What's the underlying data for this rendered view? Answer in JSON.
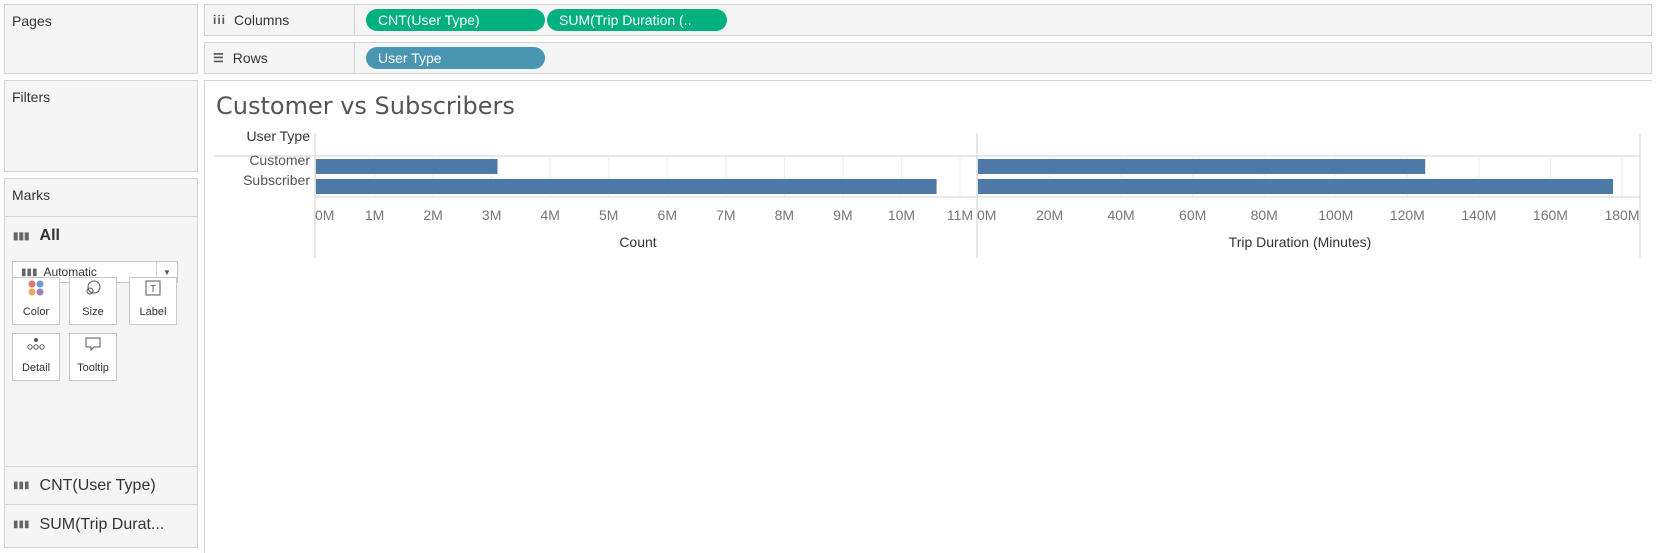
{
  "left_panel": {
    "pages_title": "Pages",
    "filters_title": "Filters",
    "marks_title": "Marks",
    "marks_all_label": "All",
    "mark_type": "Automatic",
    "cards": [
      {
        "icon": "color-icon",
        "label": "Color"
      },
      {
        "icon": "size-icon",
        "label": "Size"
      },
      {
        "icon": "label-icon",
        "label": "Label"
      },
      {
        "icon": "detail-icon",
        "label": "Detail"
      },
      {
        "icon": "tooltip-icon",
        "label": "Tooltip"
      }
    ],
    "measure_items": [
      "CNT(User Type)",
      "SUM(Trip Durat..."
    ]
  },
  "shelves": {
    "columns_label": "Columns",
    "columns_pills": [
      "CNT(User Type)",
      "SUM(Trip Duration (.."
    ],
    "rows_label": "Rows",
    "rows_pills": [
      "User Type"
    ]
  },
  "colors": {
    "measure_pill": "#00b180",
    "dimension_pill": "#4996b2",
    "bar": "#4e79a7"
  },
  "chart_title": "Customer vs Subscribers",
  "chart_data": {
    "type": "bar",
    "orientation": "horizontal",
    "row_header": "User Type",
    "categories": [
      "Customer",
      "Subscriber"
    ],
    "panes": [
      {
        "name": "CNT(User Type)",
        "xlabel": "Count",
        "values": [
          3100000,
          10600000
        ],
        "xlim": [
          0,
          11000000
        ],
        "ticks": [
          0,
          1000000,
          2000000,
          3000000,
          4000000,
          5000000,
          6000000,
          7000000,
          8000000,
          9000000,
          10000000,
          11000000
        ],
        "tick_labels": [
          "0M",
          "1M",
          "2M",
          "3M",
          "4M",
          "5M",
          "6M",
          "7M",
          "8M",
          "9M",
          "10M",
          "11M"
        ]
      },
      {
        "name": "SUM(Trip Duration (Minutes))",
        "xlabel": "Trip Duration (Minutes)",
        "values": [
          125000000,
          177500000
        ],
        "xlim": [
          0,
          180000000
        ],
        "ticks": [
          0,
          20000000,
          40000000,
          60000000,
          80000000,
          100000000,
          120000000,
          140000000,
          160000000,
          180000000
        ],
        "tick_labels": [
          "0M",
          "20M",
          "40M",
          "60M",
          "80M",
          "100M",
          "120M",
          "140M",
          "160M",
          "180M"
        ]
      }
    ]
  }
}
